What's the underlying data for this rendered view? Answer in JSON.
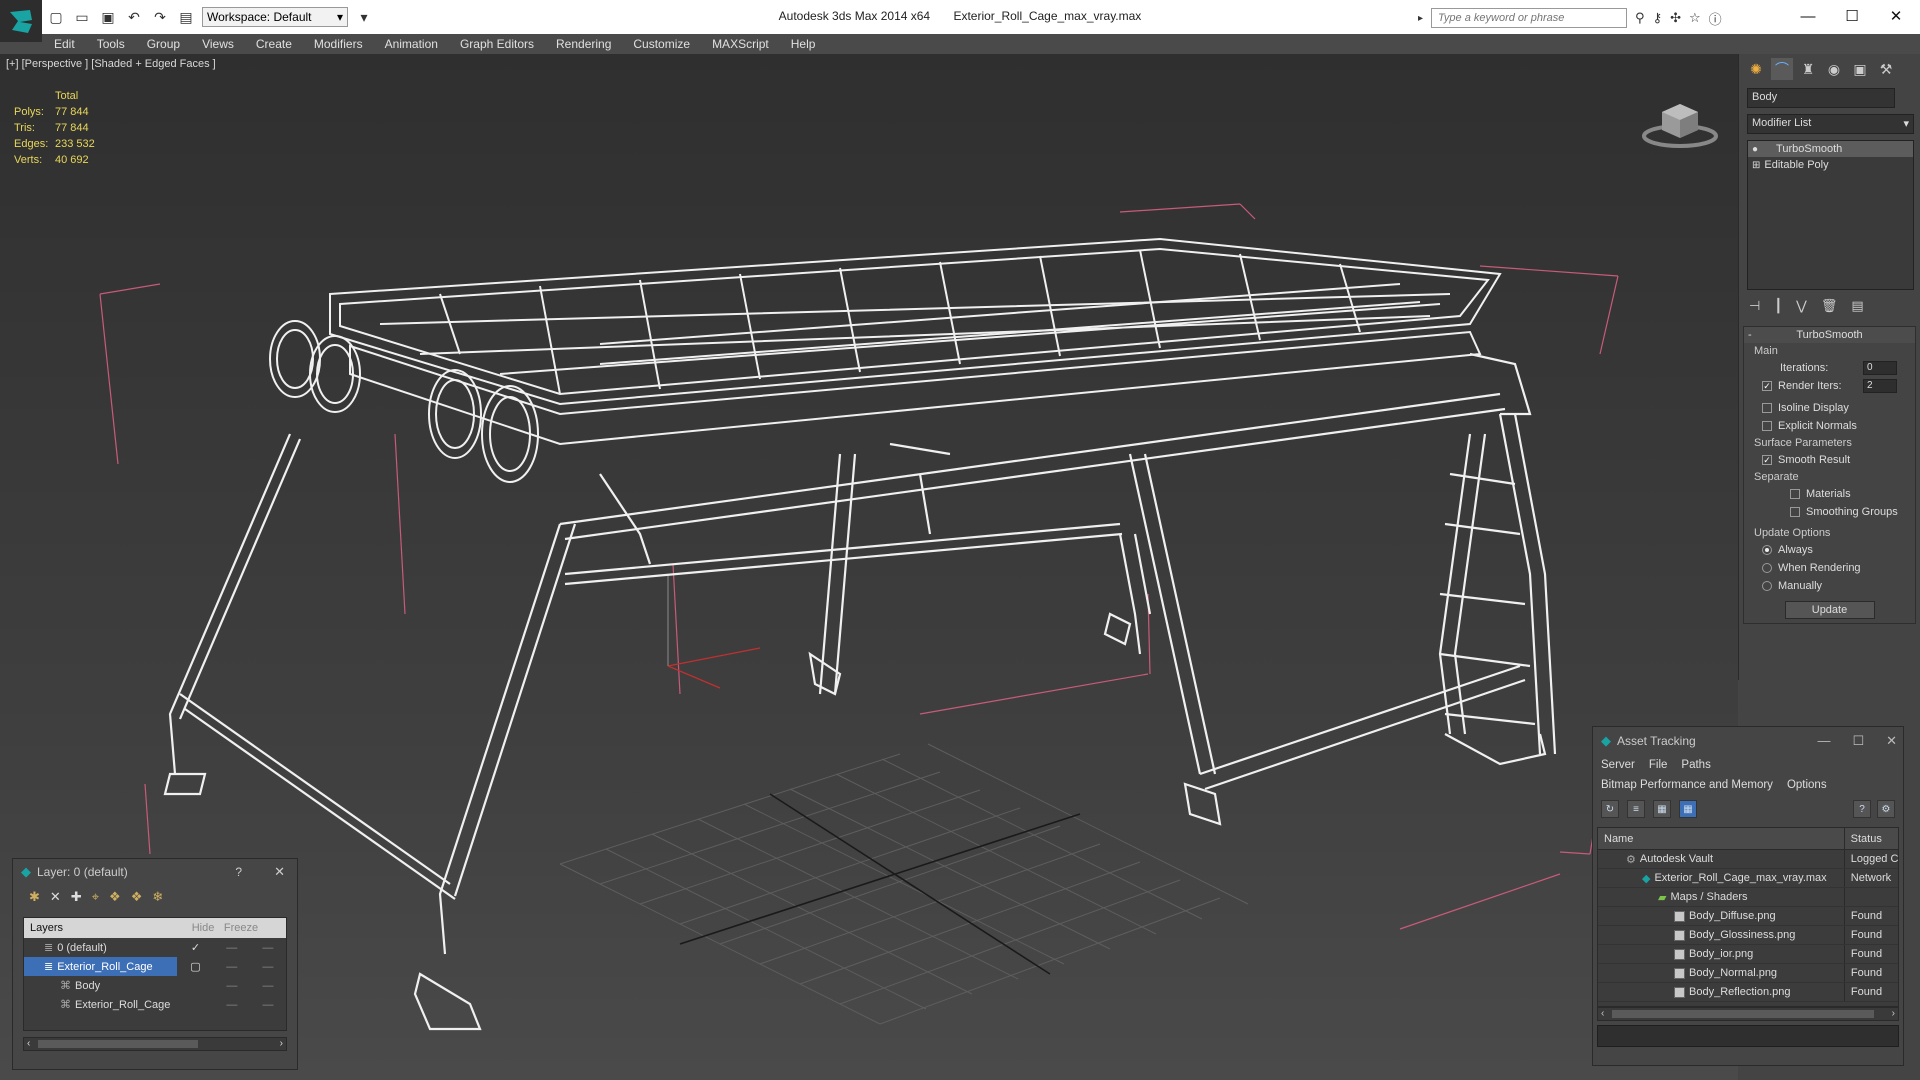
{
  "titlebar": {
    "app_name": "Autodesk 3ds Max  2014 x64",
    "file_name": "Exterior_Roll_Cage_max_vray.max",
    "workspace": "Workspace: Default",
    "search_placeholder": "Type a keyword or phrase"
  },
  "menu": [
    "Edit",
    "Tools",
    "Group",
    "Views",
    "Create",
    "Modifiers",
    "Animation",
    "Graph Editors",
    "Rendering",
    "Customize",
    "MAXScript",
    "Help"
  ],
  "viewport": {
    "label": "[+] [Perspective ] [Shaded + Edged Faces ]",
    "stats": {
      "header": "Total",
      "rows": [
        {
          "k": "Polys:",
          "v": "77 844"
        },
        {
          "k": "Tris:",
          "v": "77 844"
        },
        {
          "k": "Edges:",
          "v": "233 532"
        },
        {
          "k": "Verts:",
          "v": "40 692"
        }
      ]
    }
  },
  "command_panel": {
    "object_name": "Body",
    "modifier_list": "Modifier List",
    "stack": [
      "TurboSmooth",
      "Editable Poly"
    ],
    "rollout_title": "TurboSmooth",
    "main_group": "Main",
    "iterations_label": "Iterations:",
    "iterations_value": "0",
    "render_iters_label": "Render Iters:",
    "render_iters_value": "2",
    "isoline": "Isoline Display",
    "explicit_normals": "Explicit Normals",
    "surface_params": "Surface Parameters",
    "smooth_result": "Smooth Result",
    "separate": "Separate",
    "materials": "Materials",
    "smoothing_groups": "Smoothing Groups",
    "update_options": "Update Options",
    "always": "Always",
    "when_rendering": "When Rendering",
    "manually": "Manually",
    "update_button": "Update"
  },
  "asset_tracking": {
    "title": "Asset Tracking",
    "menu1": [
      "Server",
      "File",
      "Paths"
    ],
    "menu2": [
      "Bitmap Performance and Memory",
      "Options"
    ],
    "col_name": "Name",
    "col_status": "Status",
    "rows": [
      {
        "name": "Autodesk Vault",
        "status": "Logged C",
        "indent": 1
      },
      {
        "name": "Exterior_Roll_Cage_max_vray.max",
        "status": "Network",
        "indent": 2
      },
      {
        "name": "Maps / Shaders",
        "status": "",
        "indent": 3
      },
      {
        "name": "Body_Diffuse.png",
        "status": "Found",
        "indent": 4
      },
      {
        "name": "Body_Glossiness.png",
        "status": "Found",
        "indent": 4
      },
      {
        "name": "Body_ior.png",
        "status": "Found",
        "indent": 4
      },
      {
        "name": "Body_Normal.png",
        "status": "Found",
        "indent": 4
      },
      {
        "name": "Body_Reflection.png",
        "status": "Found",
        "indent": 4
      }
    ]
  },
  "layers": {
    "title": "Layer: 0 (default)",
    "help": "?",
    "col_layers": "Layers",
    "col_hide": "Hide",
    "col_freeze": "Freeze",
    "rows": [
      {
        "name": "0 (default)",
        "indent": 0
      },
      {
        "name": "Exterior_Roll_Cage",
        "indent": 0
      },
      {
        "name": "Body",
        "indent": 1
      },
      {
        "name": "Exterior_Roll_Cage",
        "indent": 1
      }
    ]
  },
  "colors": {
    "stats_yellow": "#e8d65a",
    "selection_blue": "#3d6fb7",
    "wire_white": "#f0f0f0",
    "bbox_pink": "#d06080"
  }
}
